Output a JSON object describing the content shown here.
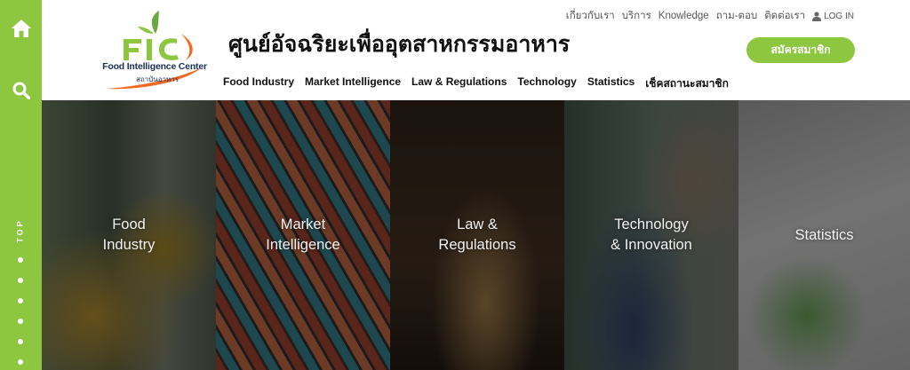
{
  "rail": {
    "top_label": "TOP",
    "home_icon": "home-icon",
    "search_icon": "search-icon",
    "dot_count": 7
  },
  "header": {
    "logo_caption": "Food Intelligence Center",
    "logo_thai": "สถาบันอาหาร",
    "site_title": "ศูนย์อัจฉริยะเพื่ออุตสาหกรรมอาหาร",
    "top_menu": [
      "เกี่ยวกับเรา",
      "บริการ",
      "Knowledge",
      "ถาม-ตอบ",
      "ติดต่อเรา"
    ],
    "login_label": "LOG IN",
    "signup_label": "สมัครสมาชิก",
    "nav": [
      "Food Industry",
      "Market Intelligence",
      "Law & Regulations",
      "Technology",
      "Statistics",
      "เช็คสถานะสมาชิก"
    ]
  },
  "panels": [
    {
      "label": "Food\nIndustry"
    },
    {
      "label": "Market\nIntelligence"
    },
    {
      "label": "Law &\nRegulations"
    },
    {
      "label": "Technology\n& Innovation"
    },
    {
      "label": "Statistics"
    }
  ],
  "colors": {
    "accent": "#8dc63f",
    "logo_orange": "#f26a21",
    "logo_navy": "#1a2f57"
  }
}
